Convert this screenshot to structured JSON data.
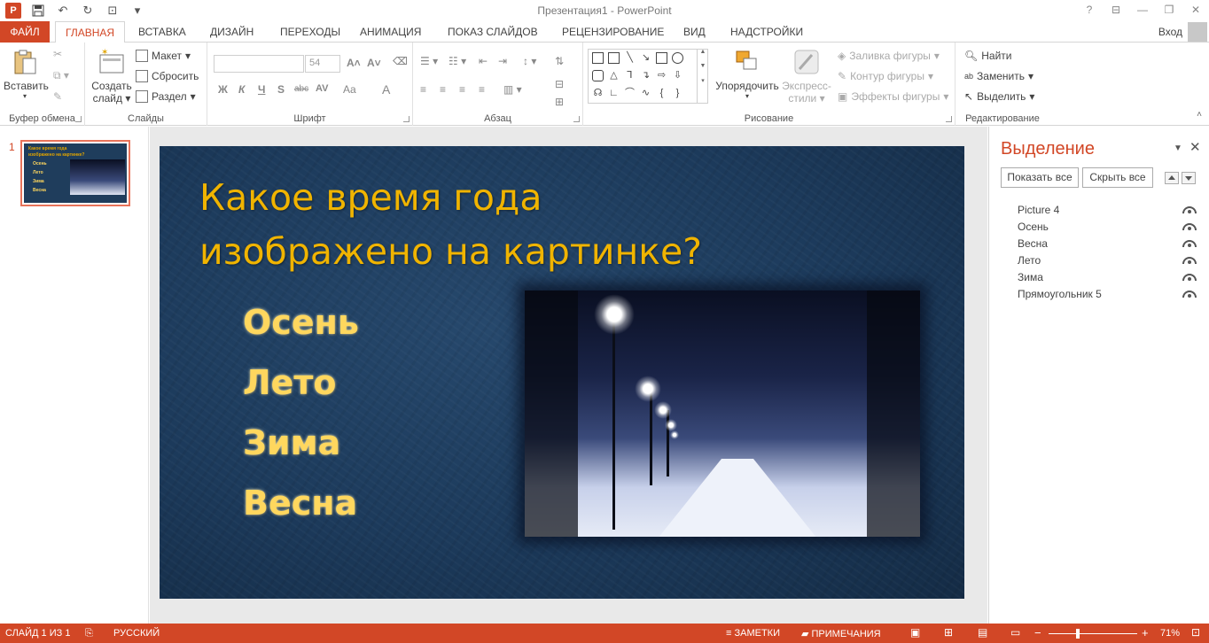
{
  "window": {
    "title": "Презентация1 - PowerPoint",
    "help": "?",
    "controls": [
      "⊟",
      "—",
      "❐",
      "✕"
    ]
  },
  "qat": {
    "app_icon_letter": "P",
    "save_icon": "save-icon",
    "undo_icon": "undo-icon",
    "redo_icon": "redo-icon",
    "present_icon": "start-from-beginning-icon"
  },
  "tabs": [
    {
      "label": "ФАЙЛ"
    },
    {
      "label": "ГЛАВНАЯ"
    },
    {
      "label": "ВСТАВКА"
    },
    {
      "label": "ДИЗАЙН"
    },
    {
      "label": "ПЕРЕХОДЫ"
    },
    {
      "label": "АНИМАЦИЯ"
    },
    {
      "label": "ПОКАЗ СЛАЙДОВ"
    },
    {
      "label": "РЕЦЕНЗИРОВАНИЕ"
    },
    {
      "label": "ВИД"
    },
    {
      "label": "НАДСТРОЙКИ"
    }
  ],
  "signin": "Вход",
  "ribbon": {
    "clipboard": {
      "label": "Буфер обмена",
      "paste": "Вставить"
    },
    "slides": {
      "label": "Слайды",
      "new_slide_1": "Создать",
      "new_slide_2": "слайд",
      "layout": "Макет",
      "reset": "Сбросить",
      "section": "Раздел"
    },
    "font": {
      "label": "Шрифт",
      "font_name": "",
      "font_size": "54",
      "bold": "Ж",
      "italic": "К",
      "underline": "Ч",
      "shadow": "S",
      "strike": "abc",
      "spacing": "AV",
      "case": "Aa",
      "color": "A"
    },
    "paragraph": {
      "label": "Абзац"
    },
    "drawing": {
      "label": "Рисование",
      "arrange": "Упорядочить",
      "quick_styles_1": "Экспресс-",
      "quick_styles_2": "стили",
      "fill": "Заливка фигуры",
      "outline": "Контур фигуры",
      "effects": "Эффекты фигуры"
    },
    "editing": {
      "label": "Редактирование",
      "find": "Найти",
      "replace": "Заменить",
      "select": "Выделить"
    }
  },
  "thumbnail": {
    "number": "1",
    "line1": "Какое время года",
    "line2": "изображено на картинке?",
    "options": [
      "Осень",
      "Лето",
      "Зима",
      "Весна"
    ]
  },
  "slide": {
    "title_line1": "Какое время года",
    "title_line2": "изображено на картинке?",
    "options": [
      "Осень",
      "Лето",
      "Зима",
      "Весна"
    ]
  },
  "selection_pane": {
    "title": "Выделение",
    "show_all": "Показать все",
    "hide_all": "Скрыть все",
    "items": [
      "Picture 4",
      "Осень",
      "Весна",
      "Лето",
      "Зима",
      "Прямоугольник 5"
    ]
  },
  "status": {
    "slide_info": "СЛАЙД 1 ИЗ 1",
    "language": "РУССКИЙ",
    "notes": "ЗАМЕТКИ",
    "comments": "ПРИМЕЧАНИЯ",
    "zoom_minus": "−",
    "zoom_plus": "+",
    "zoom": "71%"
  }
}
